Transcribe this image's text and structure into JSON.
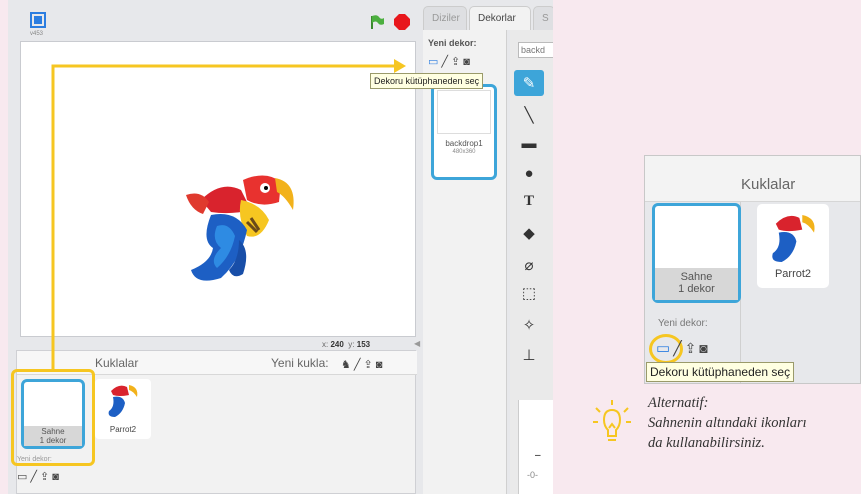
{
  "main": {
    "version": "v453",
    "coords": {
      "x_label": "x:",
      "x_value": "240",
      "y_label": "y:",
      "y_value": "153"
    },
    "sprites_title": "Kuklalar",
    "new_sprite_label": "Yeni kukla:",
    "stage_thumb": {
      "name": "Sahne",
      "sub": "1 dekor"
    },
    "new_backdrop_label": "Yeni dekor:",
    "sprite": {
      "name": "Parrot2"
    },
    "tabs": [
      "Diziler",
      "Dekorlar",
      "S"
    ],
    "backdrop_panel_label": "Yeni dekor:",
    "backdrop": {
      "name": "backdrop1",
      "size": "480x360"
    },
    "name_field_value": "backd",
    "tooltip": "Dekoru kütüphaneden seç",
    "tools": [
      "brush-icon",
      "line-icon",
      "rectangle-icon",
      "ellipse-icon",
      "text-icon",
      "fill-icon",
      "eraser-icon",
      "select-icon",
      "stamp-select-icon",
      "stamp-icon"
    ]
  },
  "inset": {
    "sprites_title": "Kuklalar",
    "stage_thumb": {
      "name": "Sahne",
      "sub": "1 dekor"
    },
    "sprite": {
      "name": "Parrot2"
    },
    "new_backdrop_label": "Yeni dekor:",
    "tooltip": "Dekoru kütüphaneden seç"
  },
  "note": {
    "title": "Alternatif:",
    "line1": "Sahnenin altındaki ikonları",
    "line2": "da kullanabilirsiniz."
  },
  "colors": {
    "accent_blue": "#3da5d9",
    "highlight_yellow": "#f6c621",
    "stop_red": "#e8171c",
    "flag_green": "#3b8a2e"
  }
}
